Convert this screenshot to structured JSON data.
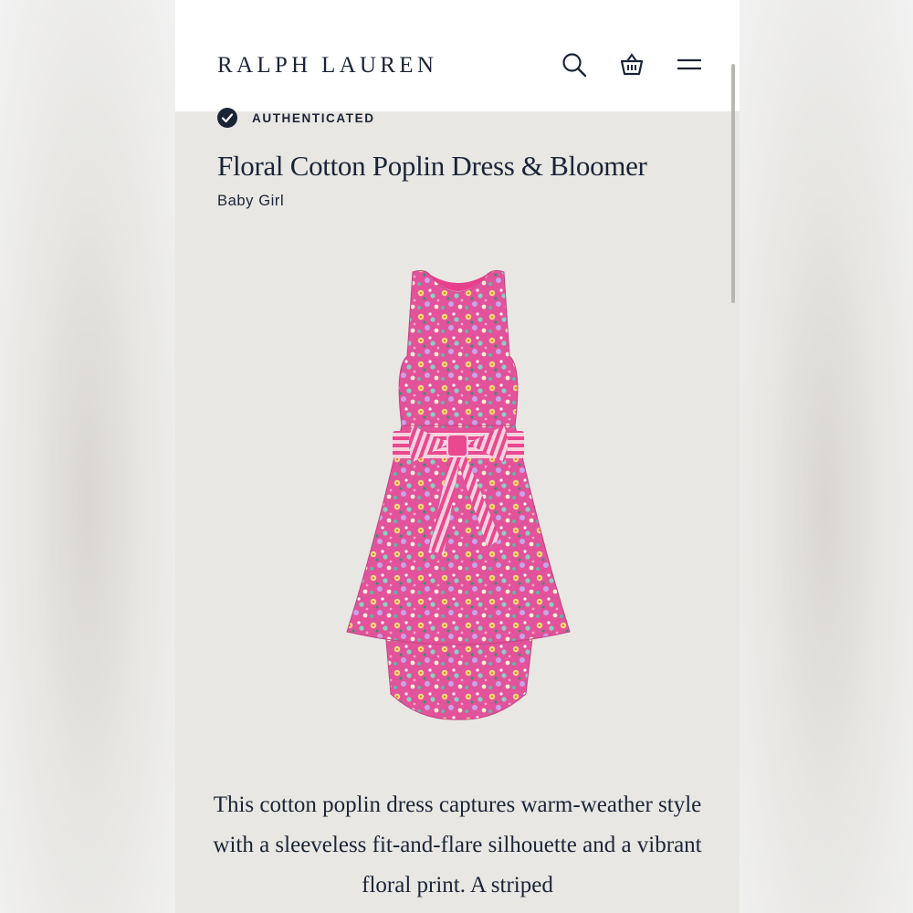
{
  "header": {
    "brand": "RALPH LAUREN",
    "icons": [
      "search-icon",
      "shopping-bag-icon",
      "menu-icon"
    ]
  },
  "product": {
    "badge": "AUTHENTICATED",
    "title": "Floral Cotton Poplin Dress & Bloomer",
    "category": "Baby Girl",
    "description": "This cotton poplin dress captures warm-weather style with a sleeveless fit-and-flare silhouette and a vibrant floral print. A striped"
  },
  "colors": {
    "navy": "#1b2436",
    "page_bg": "#e8e7e3",
    "dress_pink": "#e2539b",
    "ribbon_stripe": "#f4b4cc"
  }
}
